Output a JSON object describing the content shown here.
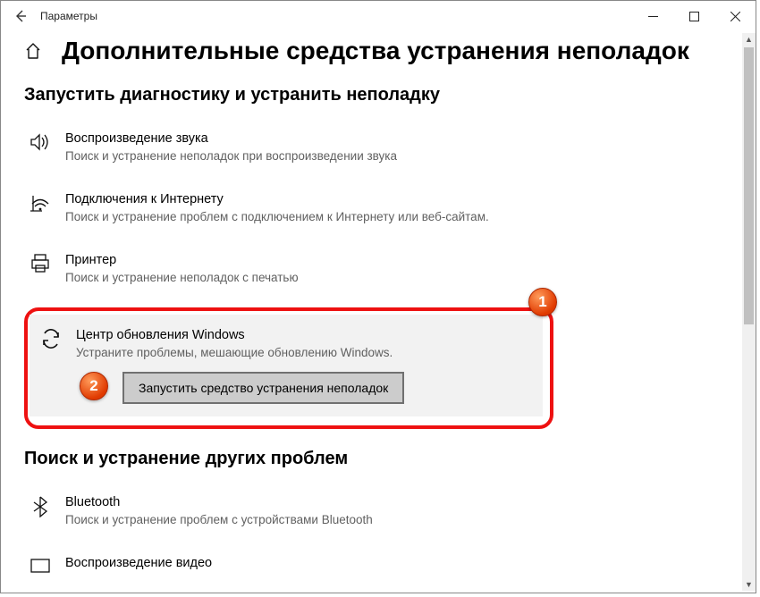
{
  "window": {
    "title": "Параметры"
  },
  "page": {
    "heading": "Дополнительные средства устранения неполадок",
    "section1_title": "Запустить диагностику и устранить неполадку",
    "section2_title": "Поиск и устранение других проблем"
  },
  "items": {
    "audio": {
      "title": "Воспроизведение звука",
      "desc": "Поиск и устранение неполадок при воспроизведении звука"
    },
    "internet": {
      "title": "Подключения к Интернету",
      "desc": "Поиск и устранение проблем с подключением к Интернету или веб-сайтам."
    },
    "printer": {
      "title": "Принтер",
      "desc": "Поиск и устранение неполадок с печатью"
    },
    "update": {
      "title": "Центр обновления Windows",
      "desc": "Устраните проблемы, мешающие обновлению Windows.",
      "button": "Запустить средство устранения неполадок"
    },
    "bluetooth": {
      "title": "Bluetooth",
      "desc": "Поиск и устранение проблем с устройствами Bluetooth"
    },
    "video": {
      "title": "Воспроизведение видео"
    }
  },
  "callouts": {
    "c1": "1",
    "c2": "2"
  }
}
